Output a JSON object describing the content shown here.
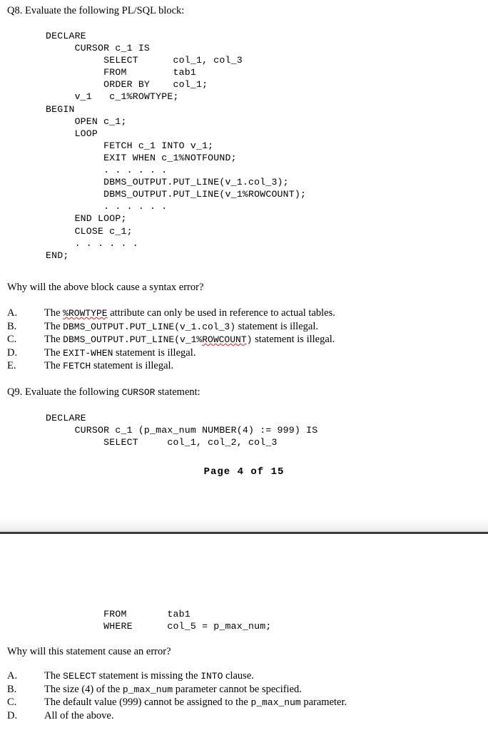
{
  "document": {
    "page_footer": "Page 4 of 15"
  },
  "q8": {
    "prompt_prefix": "Q8. Evaluate the following PL/SQL block:",
    "code": "DECLARE\n     CURSOR c_1 IS\n          SELECT      col_1, col_3\n          FROM        tab1\n          ORDER BY    col_1;\n     v_1   c_1%ROWTYPE;\nBEGIN\n     OPEN c_1;\n     LOOP\n          FETCH c_1 INTO v_1;\n          EXIT WHEN c_1%NOTFOUND;\n          . . . . . .\n          DBMS_OUTPUT.PUT_LINE(v_1.col_3);\n          DBMS_OUTPUT.PUT_LINE(v_1%ROWCOUNT);\n          . . . . . .\n     END LOOP;\n     CLOSE c_1;\n     . . . . . .\nEND;",
    "sub_question": "Why will the above block cause a syntax error?",
    "choices": [
      {
        "letter": "A.",
        "lead": "The ",
        "code": "%ROWTYPE",
        "code_misspelled": true,
        "tail": " attribute can only be used in reference to actual tables."
      },
      {
        "letter": "B.",
        "lead": "The ",
        "code": "DBMS_OUTPUT.PUT_LINE(v_1.col_3)",
        "code_misspelled": false,
        "tail": " statement is illegal."
      },
      {
        "letter": "C.",
        "lead": "The ",
        "code": "DBMS_OUTPUT.PUT_LINE(v_1%ROWCOUNT)",
        "code_misspelled": false,
        "tail": " statement is illegal.",
        "code_head": "DBMS_OUTPUT.PUT_LINE(v_1%",
        "code_spell": "ROWCOUNT",
        "code_tail": ")"
      },
      {
        "letter": "D.",
        "lead": "The ",
        "code": "EXIT-WHEN",
        "code_misspelled": false,
        "tail": " statement is illegal."
      },
      {
        "letter": "E.",
        "lead": "The ",
        "code": "FETCH",
        "code_misspelled": false,
        "tail": " statement is illegal."
      }
    ]
  },
  "q9": {
    "prompt_lead": "Q9. Evaluate the following ",
    "prompt_code": "CURSOR",
    "prompt_tail": " statement:",
    "code_part1": "DECLARE\n     CURSOR c_1 (p_max_num NUMBER(4) := 999) IS\n          SELECT     col_1, col_2, col_3",
    "code_part2": "          FROM       tab1\n          WHERE      col_5 = p_max_num;",
    "sub_question": "Why will this statement cause an error?",
    "choices": [
      {
        "letter": "A.",
        "lead": "The ",
        "code": "SELECT",
        "mid": " statement is missing the ",
        "code2": "INTO",
        "tail": " clause."
      },
      {
        "letter": "B.",
        "lead": "The size (4) of the ",
        "code": "p_max_num",
        "tail": " parameter cannot be specified."
      },
      {
        "letter": "C.",
        "lead": "The default value (999) cannot be assigned to the ",
        "code": "p_max_num",
        "tail": " parameter."
      },
      {
        "letter": "D.",
        "lead": "All of the above.",
        "code": "",
        "tail": ""
      }
    ]
  },
  "colors": {
    "text": "#000000",
    "spellcheck": "#e02020",
    "page_rule": "#3a3a3a"
  }
}
